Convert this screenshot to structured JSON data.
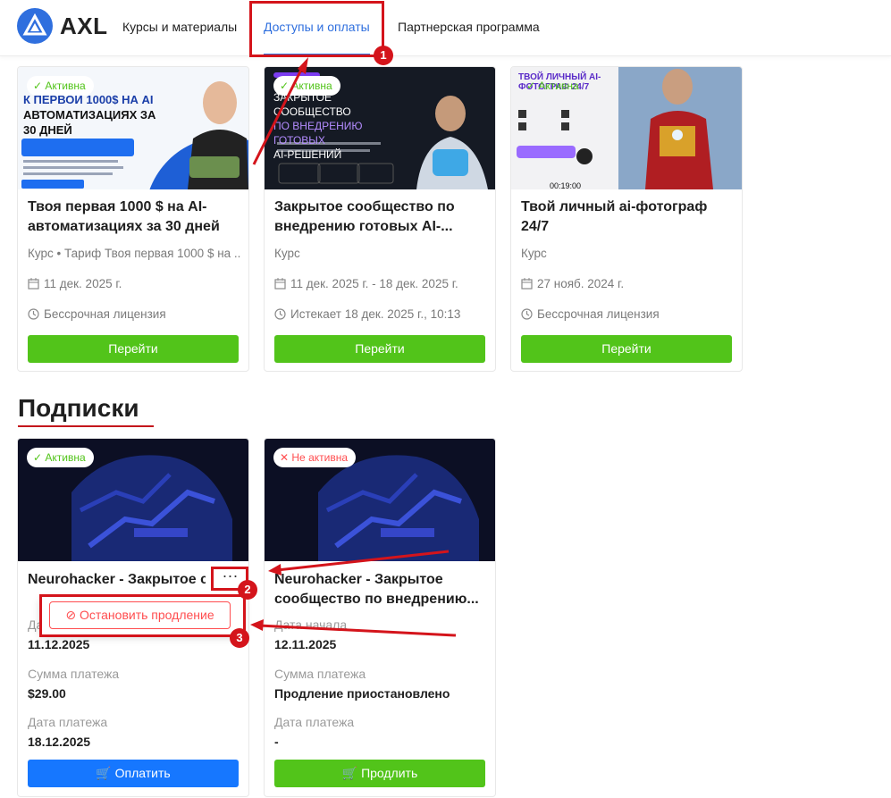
{
  "header": {
    "logo_text": "AXL",
    "nav": [
      "Курсы и материалы",
      "Доступы и оплаты",
      "Партнерская программа"
    ],
    "active_nav": "Доступы и оплаты"
  },
  "courses": [
    {
      "badge": "Активна",
      "thumb_lines": [
        "К ПЕРВОЙ 1000$ НА AI",
        "АВТОМАТИЗАЦИЯХ ЗА",
        "30 ДНЕЙ"
      ],
      "title": "Твоя первая 1000 $ на AI-автоматизациях за 30 дней",
      "type": "Курс • Тариф Твоя первая 1000 $ на ...",
      "date": "11 дек. 2025 г.",
      "license": "Бессрочная лицензия",
      "button": "Перейти"
    },
    {
      "badge": "Активна",
      "thumb_lines": [
        "ЗАКРЫТОЕ СООБЩЕСТВО",
        "ПО ВНЕДРЕНИЮ ГОТОВЫХ",
        "AI-РЕШЕНИЙ"
      ],
      "title": "Закрытое сообщество по внедрению готовых AI-...",
      "type": "Курс",
      "date": "11 дек. 2025 г.  -  18 дек. 2025 г.",
      "license": "Истекает 18 дек. 2025 г., 10:13",
      "button": "Перейти"
    },
    {
      "badge": "Активна",
      "thumb_lines": [
        "ТВОЙ ЛИЧНЫЙ AI-ФОТОГРАФ 24/7",
        "00:19:00"
      ],
      "title": "Твой личный ai-фотограф 24/7",
      "type": "Курс",
      "date": "27 нояб. 2024 г.",
      "license": "Бессрочная лицензия",
      "button": "Перейти"
    }
  ],
  "subscriptions_title": "Подписки",
  "subscriptions": [
    {
      "badge": "Активна",
      "title": "Neurohacker - Закрытое соо...",
      "more": "···",
      "start_label": "Дата начала",
      "start_value": "11.12.2025",
      "amount_label": "Сумма платежа",
      "amount_value": "$29.00",
      "pay_label": "Дата платежа",
      "pay_value": "18.12.2025",
      "button": "Оплатить"
    },
    {
      "badge": "Не активна",
      "title": "Neurohacker - Закрытое сообщество по внедрению...",
      "start_label": "Дата начала",
      "start_value": "12.11.2025",
      "amount_label": "Сумма платежа",
      "amount_value": "Продление приостановлено",
      "pay_label": "Дата платежа",
      "pay_value": "-",
      "button": "Продлить"
    }
  ],
  "popup": {
    "stop_label": "Остановить продление"
  },
  "annotations": [
    "1",
    "2",
    "3"
  ],
  "colors": {
    "accent": "#2f6fde",
    "green": "#52c41a",
    "blue": "#1677ff",
    "red": "#d4141b"
  }
}
